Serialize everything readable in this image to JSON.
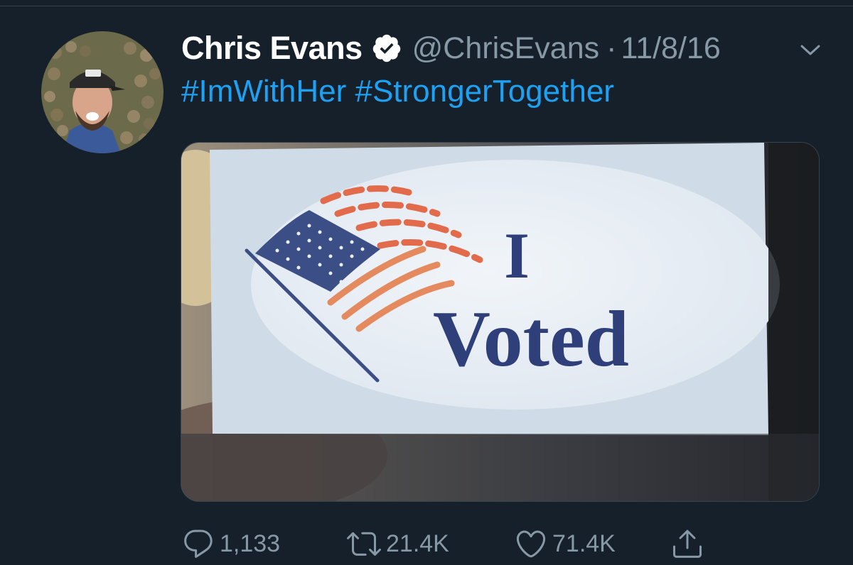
{
  "tweet": {
    "display_name": "Chris Evans",
    "handle": "@ChrisEvans",
    "separator": "·",
    "date": "11/8/16",
    "hashtags": [
      "#ImWithHer",
      "#StrongerTogether"
    ],
    "media": {
      "sticker_line1": "I",
      "sticker_line2": "Voted"
    },
    "stats": {
      "replies": "1,133",
      "retweets": "21.4K",
      "likes": "71.4K"
    }
  },
  "colors": {
    "background": "#15202b",
    "link": "#1da1f2",
    "muted": "#8899a6",
    "sticker_blue": "#2f3f7a",
    "sticker_red": "#e26b4c"
  },
  "icons": {
    "verified": "verified-badge-icon",
    "caret": "chevron-down-icon",
    "reply": "reply-icon",
    "retweet": "retweet-icon",
    "like": "heart-icon",
    "share": "share-icon"
  }
}
